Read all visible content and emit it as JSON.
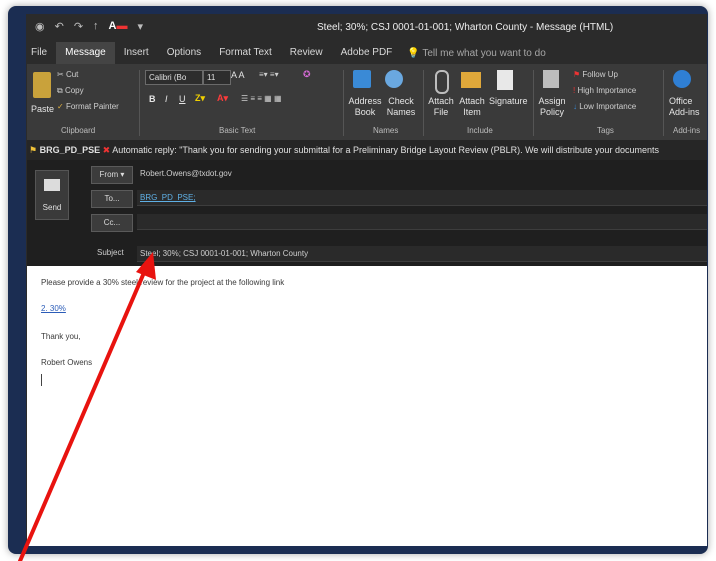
{
  "window": {
    "title": "Steel; 30%; CSJ 0001-01-001; Wharton County - Message (HTML)"
  },
  "tabs": [
    "File",
    "Message",
    "Insert",
    "Options",
    "Format Text",
    "Review",
    "Adobe PDF"
  ],
  "active_tab": "Message",
  "tell_me": "Tell me what you want to do",
  "ribbon": {
    "clipboard": {
      "paste": "Paste",
      "cut": "Cut",
      "copy": "Copy",
      "format_painter": "Format Painter",
      "label": "Clipboard"
    },
    "basic_text": {
      "font": "Calibri (Bo",
      "size": "11",
      "label": "Basic Text"
    },
    "names": {
      "address_book": "Address Book",
      "check_names": "Check Names",
      "label": "Names"
    },
    "include": {
      "attach_file": "Attach File",
      "attach_item": "Attach Item",
      "signature": "Signature",
      "label": "Include"
    },
    "tags": {
      "assign_policy": "Assign Policy",
      "follow_up": "Follow Up",
      "high_importance": "High Importance",
      "low_importance": "Low Importance",
      "label": "Tags"
    },
    "addins": {
      "office": "Office Add-ins",
      "label": "Add-ins"
    }
  },
  "infobar": {
    "sender": "BRG_PD_PSE",
    "text": "Automatic reply: \"Thank you for sending your submittal for a Preliminary Bridge Layout Review (PBLR). We will distribute your documents"
  },
  "header": {
    "send": "Send",
    "from_label": "From",
    "from_value": "Robert.Owens@txdot.gov",
    "to_label": "To...",
    "to_value": "BRG_PD_PSE;",
    "cc_label": "Cc...",
    "cc_value": "",
    "subject_label": "Subject",
    "subject_value": "Steel; 30%; CSJ 0001-01-001; Wharton County"
  },
  "body": {
    "line1": "Please provide a 30% steel review for the project at the following link",
    "link": "2. 30%",
    "thanks": "Thank you,",
    "signature": "Robert Owens"
  },
  "colors": {
    "frame": "#1b2d52",
    "arrow": "#e8130f",
    "link": "#2b5cb8"
  }
}
